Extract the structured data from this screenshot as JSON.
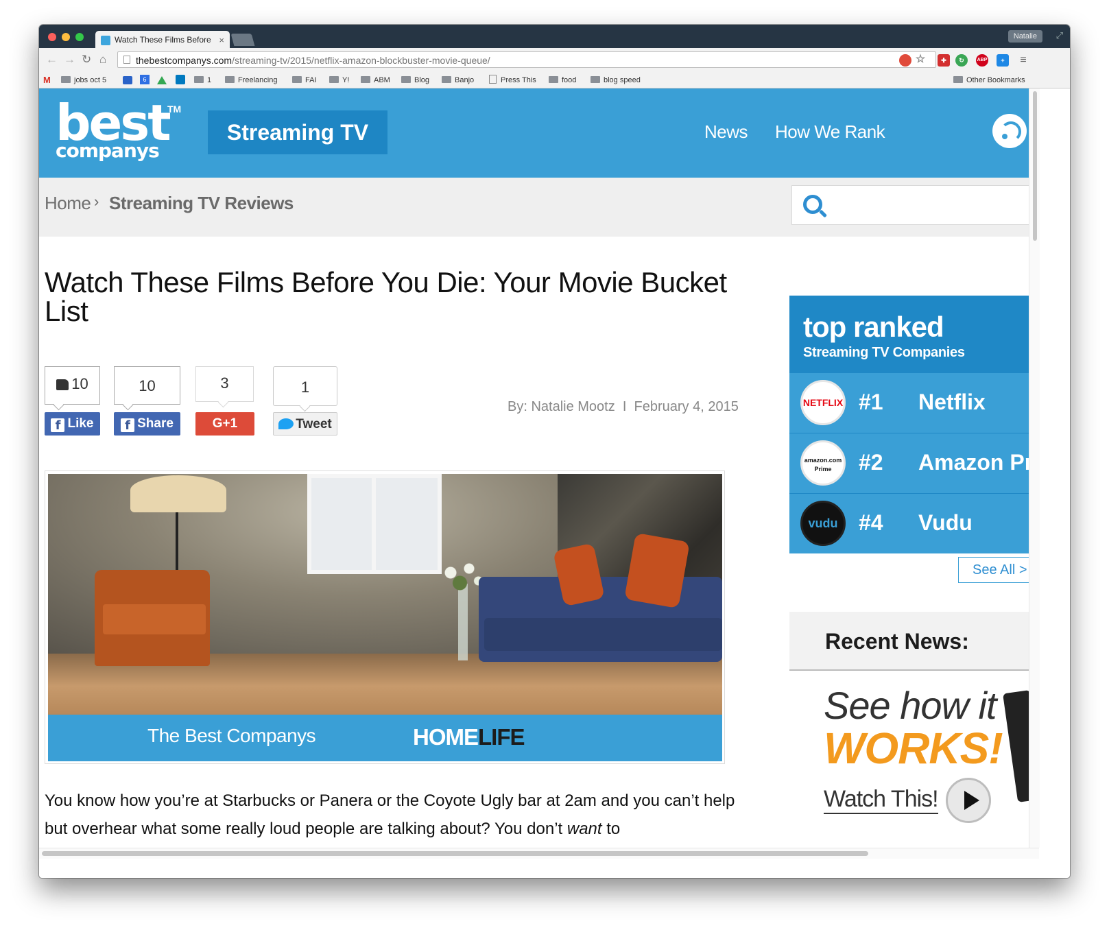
{
  "browser": {
    "tab_title": "Watch These Films Before",
    "tab_close": "×",
    "profile_name": "Natalie",
    "url_host": "thebestcompanys.com",
    "url_path": "/streaming-tv/2015/netflix-amazon-blockbuster-movie-queue/",
    "bookmarks": [
      "jobs oct 5",
      "1",
      "Freelancing",
      "FAI",
      "Y!",
      "ABM",
      "Blog",
      "Banjo",
      "Press This",
      "food",
      "blog speed",
      "Other Bookmarks"
    ],
    "extension_icons": [
      "opera-icon",
      "star-icon",
      "lastpass-icon",
      "refresh-green-icon",
      "abp-icon",
      "plus-icon",
      "menu-icon"
    ],
    "abp_label": "ABP",
    "gcal_badge": "6"
  },
  "site": {
    "logo_best": "best",
    "logo_tm": "TM",
    "logo_companys": "companys",
    "section": "Streaming TV",
    "nav": [
      "News",
      "How We Rank"
    ],
    "accent_color": "#3a9fd6",
    "dark_accent_color": "#1f88c6"
  },
  "breadcrumb": {
    "home": "Home",
    "separator": "›",
    "current": "Streaming TV Reviews"
  },
  "article": {
    "title": "Watch These Films Before You Die: Your Movie Bucket List",
    "share": {
      "like_count": "10",
      "share_count": "10",
      "gplus_count": "3",
      "tweet_count": "1",
      "like_label": "Like",
      "share_label": "Share",
      "gplus_label": "G+1",
      "tweet_label": "Tweet",
      "fb_glyph": "f"
    },
    "byline": "By: Natalie Mootz  I  February 4, 2015",
    "hero_brand": "The Best Companys",
    "hero_home": "HOME",
    "hero_life": "LIFE",
    "body_1": "You know how you’re at Starbucks or Panera or the Coyote Ugly bar at 2am and you can’t help but overhear what some really loud people are talking about? You don’t ",
    "body_em": "want",
    "body_2": " to"
  },
  "sidebar": {
    "top_title": "top ranked",
    "top_sub": "Streaming TV Companies",
    "rankings": [
      {
        "rank": "#1",
        "name": "Netflix",
        "logo": "NETFLIX"
      },
      {
        "rank": "#2",
        "name": "Amazon Prime",
        "logo": "amazon.com Prime"
      },
      {
        "rank": "#4",
        "name": "Vudu",
        "logo": "vudu"
      }
    ],
    "see_all": "See All >",
    "news_title": "Recent News:",
    "promo_see": "See how it",
    "promo_works": "WORKS!",
    "promo_watch": "Watch This!"
  }
}
